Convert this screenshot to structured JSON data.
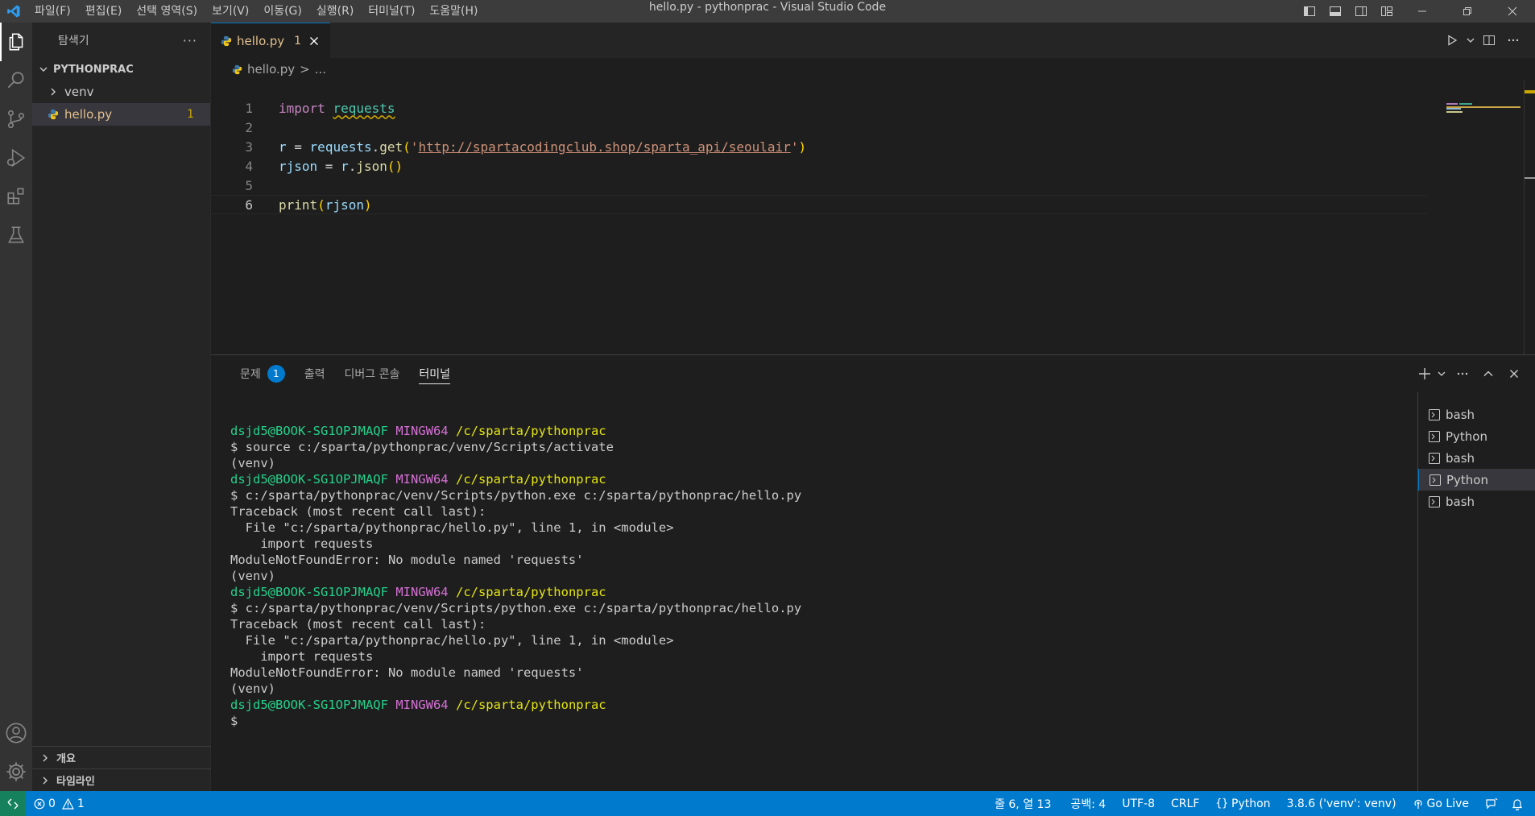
{
  "titlebar": {
    "menu": [
      "파일(F)",
      "편집(E)",
      "선택 영역(S)",
      "보기(V)",
      "이동(G)",
      "실행(R)",
      "터미널(T)",
      "도움말(H)"
    ],
    "title": "hello.py - pythonprac - Visual Studio Code"
  },
  "sidebar": {
    "header": "탐색기",
    "more": "···",
    "folder": "PYTHONPRAC",
    "items": [
      {
        "label": "venv"
      },
      {
        "label": "hello.py",
        "badge": "1"
      }
    ],
    "sections": [
      "개요",
      "타임라인"
    ]
  },
  "editor": {
    "tab": {
      "label": "hello.py",
      "badge": "1"
    },
    "breadcrumb": {
      "file": "hello.py",
      "sep": ">",
      "rest": "..."
    },
    "line_numbers": [
      "1",
      "2",
      "3",
      "4",
      "5",
      "6"
    ],
    "code": {
      "l1_kw": "import",
      "l1_mod": "requests",
      "l3_var": "r",
      "l3_eq": " = ",
      "l3_obj": "requests",
      "l3_dot": ".",
      "l3_fn": "get",
      "l3_open": "(",
      "l3_q1": "'",
      "l3_url": "http://spartacodingclub.shop/sparta_api/seoulair",
      "l3_q2": "'",
      "l3_close": ")",
      "l4_var": "rjson",
      "l4_eq": " = ",
      "l4_obj": "r",
      "l4_dot": ".",
      "l4_fn": "json",
      "l4_paren": "()",
      "l6_fn": "print",
      "l6_open": "(",
      "l6_arg": "rjson",
      "l6_close": ")"
    }
  },
  "panel": {
    "tabs": [
      {
        "label": "문제",
        "badge": "1"
      },
      {
        "label": "출력"
      },
      {
        "label": "디버그 콘솔"
      },
      {
        "label": "터미널"
      }
    ],
    "terminal": {
      "user": "dsjd5@BOOK-SG1OPJMAQF",
      "host": "MINGW64",
      "path": "/c/sparta/pythonprac",
      "l_source": "$ source c:/sparta/pythonprac/venv/Scripts/activate",
      "venv": "(venv)",
      "l_run": "$ c:/sparta/pythonprac/venv/Scripts/python.exe c:/sparta/pythonprac/hello.py",
      "tb1": "Traceback (most recent call last):",
      "tb2": "  File \"c:/sparta/pythonprac/hello.py\", line 1, in <module>",
      "tb3": "    import requests",
      "tb4": "ModuleNotFoundError: No module named 'requests'",
      "prompt": "$"
    },
    "terminal_list": [
      {
        "label": "bash"
      },
      {
        "label": "Python"
      },
      {
        "label": "bash"
      },
      {
        "label": "Python",
        "active": true
      },
      {
        "label": "bash"
      }
    ]
  },
  "statusbar": {
    "errors": "0",
    "warnings": "1",
    "position": "줄 6, 열 13",
    "spaces": "공백: 4",
    "encoding": "UTF-8",
    "eol": "CRLF",
    "language": "Python",
    "interpreter": "3.8.6 ('venv': venv)",
    "golive": "Go Live"
  },
  "colors": {
    "accent": "#007acc",
    "statusbar": "#007acc",
    "warning": "#cca700",
    "term_user": "#23d18b",
    "term_host": "#d670d6",
    "term_path": "#e5e510"
  }
}
